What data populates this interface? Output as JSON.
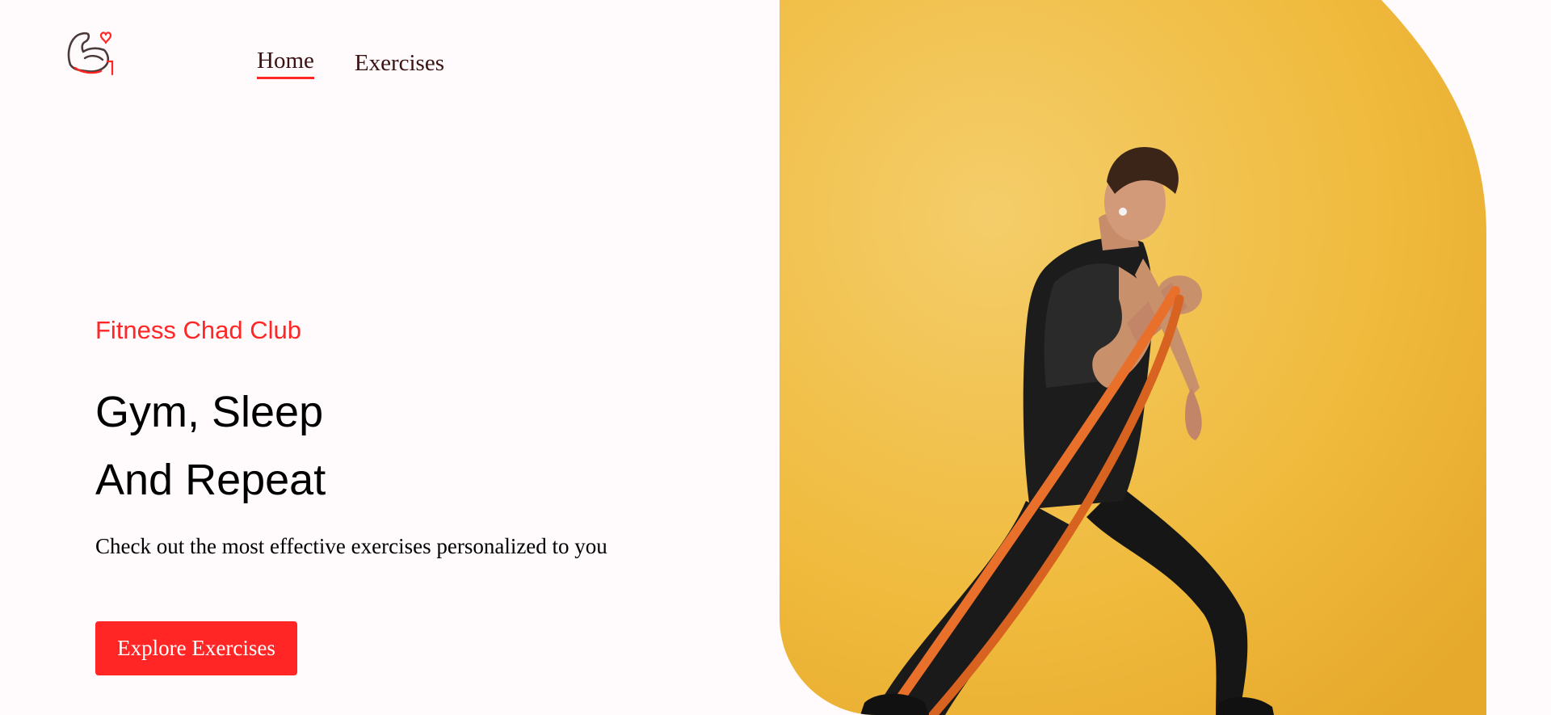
{
  "header": {
    "logo_icon": "flexed-arm-heart-icon",
    "nav": [
      {
        "label": "Home",
        "active": true
      },
      {
        "label": "Exercises",
        "active": false
      }
    ]
  },
  "hero": {
    "eyebrow": "Fitness Chad Club",
    "headline_line1": "Gym, Sleep",
    "headline_line2": "And Repeat",
    "subtitle": "Check out the most effective exercises personalized to you",
    "cta_label": "Explore Exercises",
    "image_icon": "athlete-resistance-band-photo"
  },
  "colors": {
    "accent": "#ff2625",
    "background": "#fffafb",
    "photo_background": "#f0bb3e",
    "nav_text": "#3a1212"
  }
}
